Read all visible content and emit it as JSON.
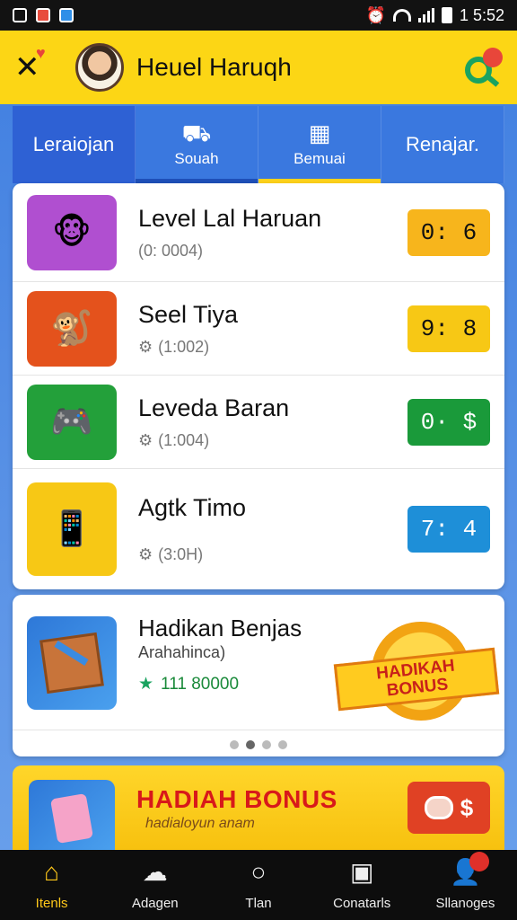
{
  "status_bar": {
    "time": "1 5:52"
  },
  "header": {
    "title": "Heuel Haruqh"
  },
  "tabs": [
    {
      "label": "Leraiojan"
    },
    {
      "label": "Souah"
    },
    {
      "label": "Bemuai"
    },
    {
      "label": "Renajar."
    }
  ],
  "list": [
    {
      "title": "Level Lal Haruan",
      "sub": "(0: 0004)",
      "price": "0: 6",
      "price_color": "#f7b51c"
    },
    {
      "title": "Seel Tiya",
      "sub": "(1:002)",
      "price": "9: 8",
      "price_color": "#f7c815"
    },
    {
      "title": "Leveda Baran",
      "sub": "(1:004)",
      "price": "0· $",
      "price_color": "#1a9a3a"
    },
    {
      "title": "Agtk Timo",
      "sub": "(3:0H)",
      "price": "7: 4",
      "price_color": "#1e8fd8"
    }
  ],
  "bonus": {
    "title": "Hadikan Benjas",
    "sub": "Arahahinca)",
    "points": "111 80000",
    "badge_line1": "HADIKAH",
    "badge_line2": "BONUS"
  },
  "promo": {
    "title": "HADIAH BONUS",
    "sub": "hadialoyun anam",
    "button": "$"
  },
  "bottom_nav": [
    {
      "label": "Itenls"
    },
    {
      "label": "Adagen"
    },
    {
      "label": "Tlan"
    },
    {
      "label": "Conatarls"
    },
    {
      "label": "Sllanoges"
    }
  ],
  "colors": {
    "accent": "#fcd615",
    "primary": "#3a78df"
  }
}
